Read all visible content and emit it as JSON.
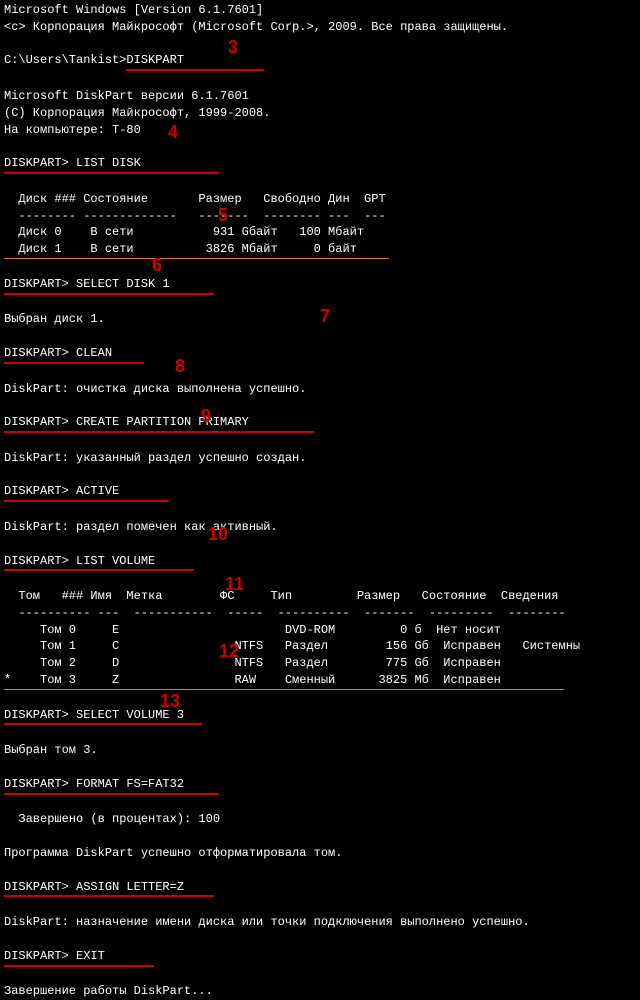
{
  "header": {
    "version_line": "Microsoft Windows [Version 6.1.7601]",
    "copyright_line": "<с> Корпорация Майкрософт (Microsoft Corp.>, 2009. Все права защищены."
  },
  "prompt_path": "C:\\Users\\Tankist>",
  "cmd_diskpart": "DISKPART",
  "diskpart_info": {
    "version": "Microsoft DiskPart версии 6.1.7601",
    "copyright": "(С) Корпорация Майкрософт, 1999-2008.",
    "computer": "На компьютере: T-80"
  },
  "dp_prompt": "DISKPART> ",
  "cmd_list_disk": "LIST DISK",
  "disk_header": "  Диск ### Состояние       Размер   Свободно Дин  GPT",
  "disk_divider": "  -------- -------------   -------  -------- ---  ---",
  "disk_rows": {
    "r0": "  Диск 0    В сети           931 Gбайт   100 Мбайт",
    "r1": "  Диск 1    В сети          3826 Мбайт     0 байт"
  },
  "cmd_select_disk": "SELECT DISK 1",
  "msg_disk_selected": "Выбран диск 1.",
  "cmd_clean": "CLEAN",
  "msg_clean": "DiskPart: очистка диска выполнена успешно.",
  "cmd_create": "CREATE PARTITION PRIMARY",
  "msg_create": "DiskPart: указанный раздел успешно создан.",
  "cmd_active": "ACTIVE",
  "msg_active": "DiskPart: раздел помечен как активный.",
  "cmd_list_volume": "LIST VOLUME",
  "vol_header": "  Том   ### Имя  Метка        ФС     Тип         Размер   Состояние  Сведения",
  "vol_divider": "  ---------- ---  -----------  -----  ----------  -------  ---------  --------",
  "vol_rows": {
    "r0": "     Том 0     E                       DVD-ROM         0 б  Нет носит",
    "r1": "     Том 1     C                NTFS   Раздел        156 Gб  Исправен   Системны",
    "r2": "     Том 2     D                NTFS   Раздел        775 Gб  Исправен",
    "r3": "*    Том 3     Z                RAW    Сменный      3825 Мб  Исправен"
  },
  "cmd_select_vol": "SELECT VOLUME 3",
  "msg_vol_selected": "Выбран том 3.",
  "cmd_format": "FORMAT FS=FAT32",
  "msg_format_progress": "  Завершено (в процентах): 100",
  "msg_format_done": "Программа DiskPart успешно отформатировала том.",
  "cmd_assign": "ASSIGN LETTER=Z",
  "msg_assign": "DiskPart: назначение имени диска или точки подключения выполнено успешно.",
  "cmd_exit": "EXIT",
  "msg_exit": "Завершение работы DiskPart...",
  "steps": {
    "s3": "3",
    "s4": "4",
    "s5": "5",
    "s6": "6",
    "s7": "7",
    "s8": "8",
    "s9": "9",
    "s10": "10",
    "s11": "11",
    "s12": "12",
    "s13": "13"
  }
}
